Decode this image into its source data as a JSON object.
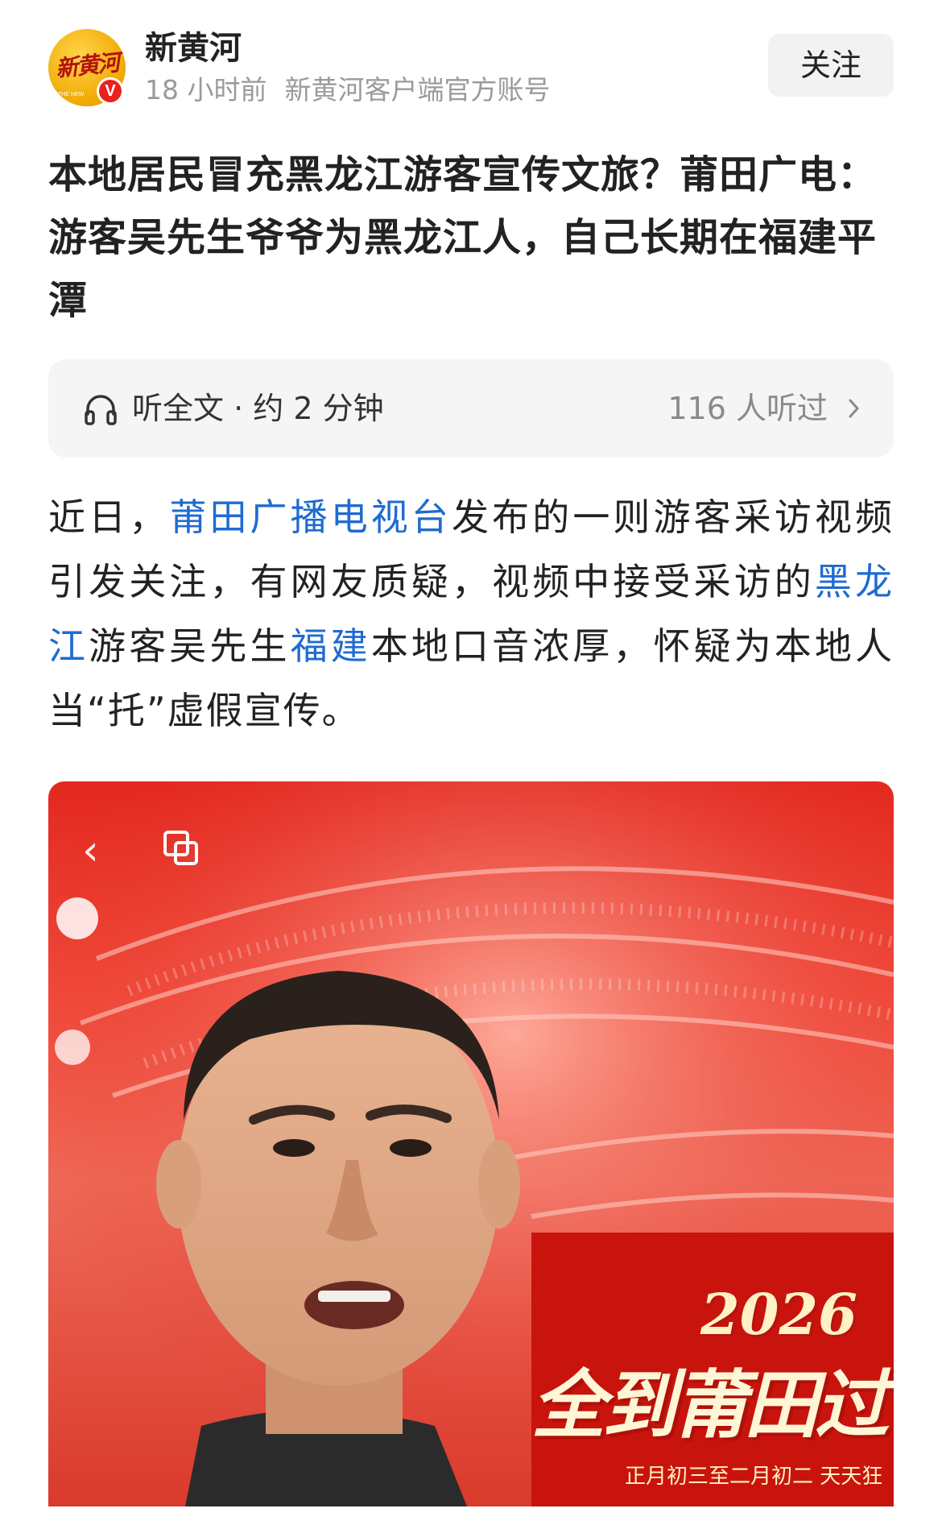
{
  "header": {
    "author_name": "新黄河",
    "avatar_logo_text": "新黄河",
    "avatar_sub_text": "THE NEW",
    "verify_badge": "V",
    "time_ago": "18 小时前",
    "account_desc": "新黄河客户端官方账号",
    "follow_label": "关注"
  },
  "article": {
    "title": "本地居民冒充黑龙江游客宣传文旅？莆田广电：游客吴先生爷爷为黑龙江人，自己长期在福建平潭",
    "audio": {
      "icon": "headphones-icon",
      "label": "听全文 · 约 2 分钟",
      "listeners": "116 人听过"
    },
    "body": {
      "p1_a": "近日，",
      "link1": "莆田广播电视台",
      "p1_b": "发布的一则游客采访视频引发关注，有网友质疑，视频中接受采访的",
      "link2": "黑龙江",
      "p1_c": "游客吴先生",
      "link3": "福建",
      "p1_d": "本地口音浓厚，怀疑为本地人当“托”虚假宣传。"
    }
  },
  "photo": {
    "banner_year": "2026",
    "banner_title": "全到莆田过",
    "banner_dates": "正月初三至二月初二 天天狂",
    "colors": {
      "background": "#e3281f",
      "banner_text": "#fff6d6"
    }
  },
  "colors": {
    "link": "#1f6bd1",
    "verify": "#e8231f",
    "muted": "#9a9a9a"
  }
}
